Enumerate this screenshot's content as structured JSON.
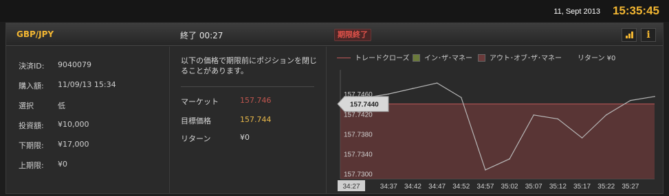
{
  "topbar": {
    "date": "11, Sept 2013",
    "time": "15:35:45"
  },
  "panel": {
    "pair": "GBP/JPY",
    "end_label": "終了  00:27",
    "expired_badge": "期限終了",
    "icons": [
      "bar-chart-icon",
      "info-icon"
    ]
  },
  "details": [
    {
      "label": "決済ID:",
      "value": "9040079"
    },
    {
      "label": "購入額:",
      "value": "11/09/13 15:34"
    },
    {
      "label": "選択",
      "value": "低"
    },
    {
      "label": "投資額:",
      "value": "¥10,000"
    },
    {
      "label": "下期限:",
      "value": "¥17,000"
    },
    {
      "label": "上期限:",
      "value": "¥0"
    }
  ],
  "summary": {
    "notice": "以下の価格で期限前にポジションを閉じることがあります。",
    "rows": [
      {
        "label": "マーケット",
        "value": "157.746"
      },
      {
        "label": "目標価格",
        "value": "157.744"
      },
      {
        "label": "リターン",
        "value": "¥0"
      }
    ]
  },
  "legend": {
    "close_line": "トレードクローズ",
    "in_money": "イン･ザ･マネー",
    "out_money": "アウト･オブ･ザ･マネー",
    "return_label": "リターン ¥0"
  },
  "colors": {
    "accent": "#f2b632",
    "market_value": "#c0564f",
    "target_value": "#e8b84a",
    "in_money": "#6a7a3a",
    "out_money": "#6a3a3a",
    "line": "#b8b8b8"
  },
  "chart_data": {
    "type": "line",
    "x": [
      "34:27",
      "34:32",
      "34:37",
      "34:42",
      "34:47",
      "34:52",
      "34:57",
      "35:02",
      "35:07",
      "35:12",
      "35:17",
      "35:22",
      "35:27",
      "35:30"
    ],
    "xticks": [
      "34:27",
      "34:37",
      "34:42",
      "34:47",
      "34:52",
      "34:57",
      "35:02",
      "35:07",
      "35:12",
      "35:17",
      "35:22",
      "35:27"
    ],
    "highlighted_tick": "34:27",
    "y": [
      157.744,
      157.7452,
      157.746,
      157.7471,
      157.7482,
      157.7453,
      157.7308,
      157.733,
      157.7418,
      157.741,
      157.7372,
      157.7418,
      157.7447,
      157.7455
    ],
    "yticks": [
      "157.7460",
      "157.7420",
      "157.7380",
      "157.7340",
      "157.7300"
    ],
    "ylim": [
      157.729,
      157.75
    ],
    "target": 157.744,
    "target_label": "157.7440",
    "grid": false
  }
}
